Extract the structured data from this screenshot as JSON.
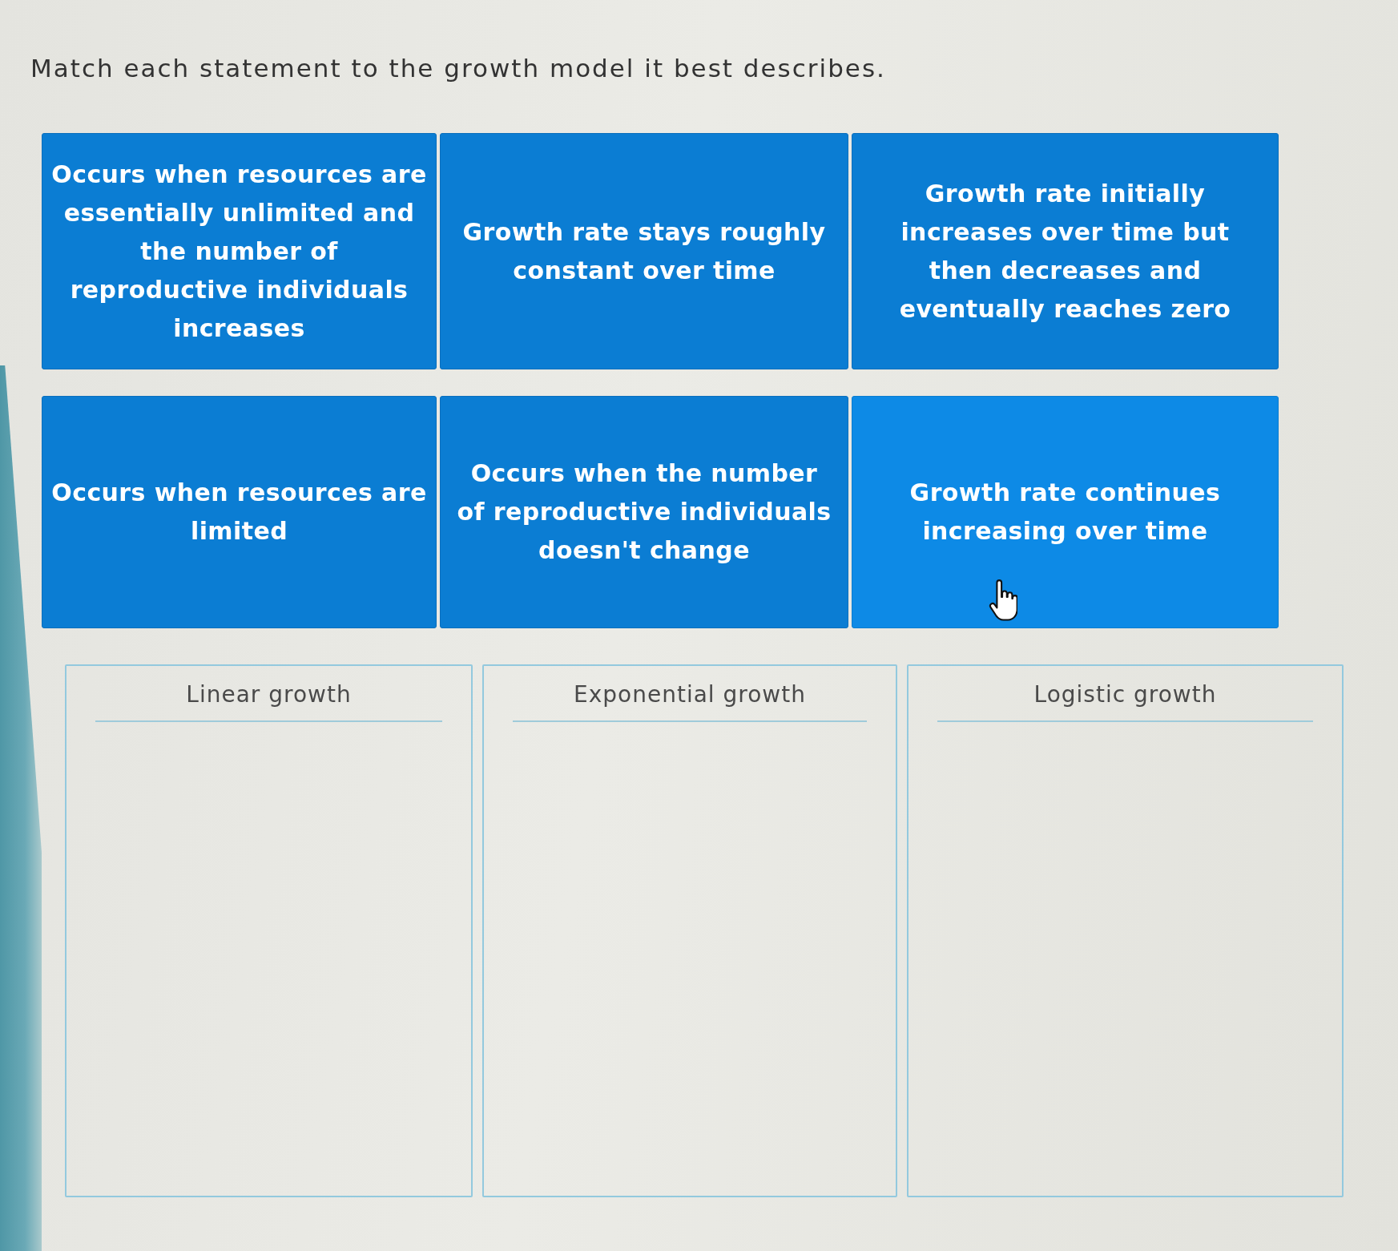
{
  "prompt": "Match each statement to the growth model it best describes.",
  "statements": [
    {
      "text": "Occurs when resources are essentially unlimited and the number of reproductive individuals increases",
      "hovered": false
    },
    {
      "text": "Growth rate stays roughly constant over time",
      "hovered": false
    },
    {
      "text": "Growth rate initially increases over time but then decreases and eventually reaches zero",
      "hovered": false
    },
    {
      "text": "Occurs when resources are limited",
      "hovered": false
    },
    {
      "text": "Occurs when the number of reproductive individuals doesn't change",
      "hovered": false
    },
    {
      "text": "Growth rate continues increasing over time",
      "hovered": true
    }
  ],
  "categories": [
    {
      "label": "Linear growth"
    },
    {
      "label": "Exponential growth"
    },
    {
      "label": "Logistic growth"
    }
  ]
}
